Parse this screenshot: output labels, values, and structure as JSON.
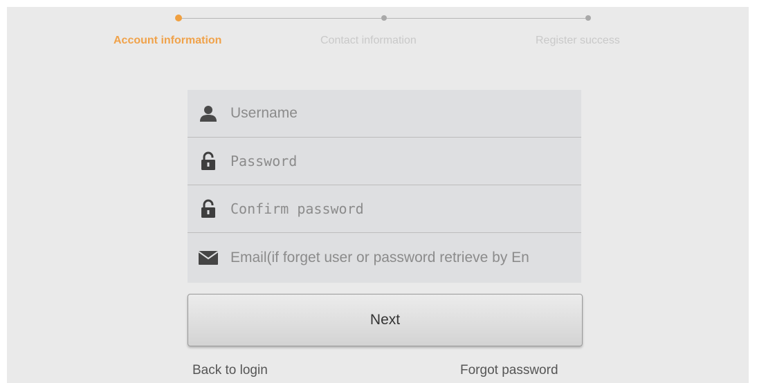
{
  "stepper": {
    "steps": [
      {
        "label": "Account information",
        "active": true
      },
      {
        "label": "Contact information",
        "active": false
      },
      {
        "label": "Register success",
        "active": false
      }
    ],
    "active_color": "#f0a24a"
  },
  "form": {
    "username": {
      "placeholder": "Username",
      "icon": "user-icon"
    },
    "password": {
      "placeholder": "Password",
      "icon": "lock-icon"
    },
    "confirm_password": {
      "placeholder": "Confirm password",
      "icon": "lock-icon"
    },
    "email": {
      "placeholder": "Email(if forget user or password retrieve by En",
      "icon": "envelope-icon"
    }
  },
  "buttons": {
    "next_label": "Next"
  },
  "links": {
    "back_to_login": "Back to login",
    "forgot_password": "Forgot password"
  }
}
